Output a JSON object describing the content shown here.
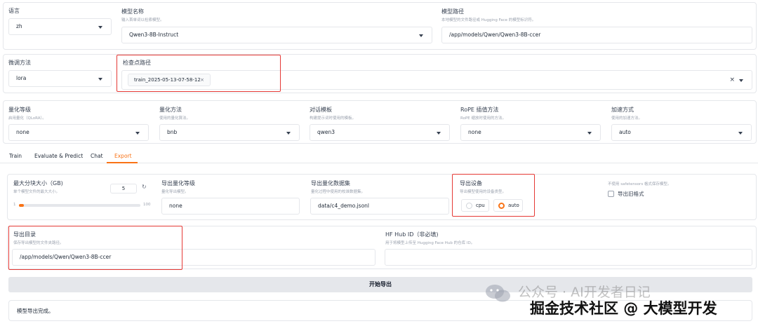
{
  "top": {
    "lang": {
      "label": "语言",
      "value": "zh"
    },
    "model_name": {
      "label": "模型名称",
      "hint": "输入首单词以检索模型。",
      "value": "Qwen3-8B-Instruct"
    },
    "model_path": {
      "label": "模型路径",
      "hint": "本地模型的文件路径或 Hugging Face 的模型标识符。",
      "value": "/app/models/Qwen/Qwen3-8B-ccer"
    }
  },
  "finetune": {
    "method": {
      "label": "微调方法",
      "value": "lora"
    },
    "checkpoint": {
      "label": "检查点路径",
      "chip": "train_2025-05-13-07-58-12",
      "chip_close": "×",
      "clear": "×"
    }
  },
  "quant": {
    "level": {
      "label": "量化等级",
      "hint": "启用量化（QLoRA）。",
      "value": "none"
    },
    "method": {
      "label": "量化方法",
      "hint": "使用的量化算法。",
      "value": "bnb"
    },
    "template": {
      "label": "对话模板",
      "hint": "构建提示词时使用的模板。",
      "value": "qwen3"
    },
    "rope": {
      "label": "RoPE 插值方法",
      "hint": "RoPE 缩放时使用的方法。",
      "value": "none"
    },
    "booster": {
      "label": "加速方式",
      "hint": "使用的加速方法。",
      "value": "auto"
    }
  },
  "tabs": [
    "Train",
    "Evaluate & Predict",
    "Chat",
    "Export"
  ],
  "export": {
    "shard": {
      "label": "最大分块大小（GB)",
      "hint": "单个模型文件的最大大小。",
      "value": "5",
      "reset": "↻",
      "min": "1",
      "max": "100",
      "level": 0.04
    },
    "quant_bit": {
      "label": "导出量化等级",
      "hint": "量化导出模型。",
      "value": "none"
    },
    "quant_dataset": {
      "label": "导出量化数据集",
      "hint": "量化过程中使用的校准数据集。",
      "value": "data/c4_demo.jsonl"
    },
    "device": {
      "label": "导出设备",
      "hint": "导出模型使用的设备类型。",
      "options": [
        "cpu",
        "auto"
      ],
      "selected": "auto"
    },
    "legacy": {
      "hint": "不使用 safetensors 格式保存模型。",
      "label": "导出旧格式"
    },
    "dir": {
      "label": "导出目录",
      "hint": "保存导出模型的文件夹路径。",
      "value": "/app/models/Qwen/Qwen3-8B-ccer"
    },
    "hub": {
      "label": "HF Hub ID（非必填)",
      "hint": "用于将模型上传至 Hugging Face Hub 的仓库 ID。",
      "value": ""
    },
    "button": "开始导出",
    "status": "模型导出完成。"
  },
  "watermark": {
    "line1": "公众号 · AI开发者日记",
    "line2": "掘金技术社区 @ 大模型开发"
  },
  "colors": {
    "accent": "#f97316",
    "highlight": "#e53935",
    "border": "#e5e7eb"
  }
}
